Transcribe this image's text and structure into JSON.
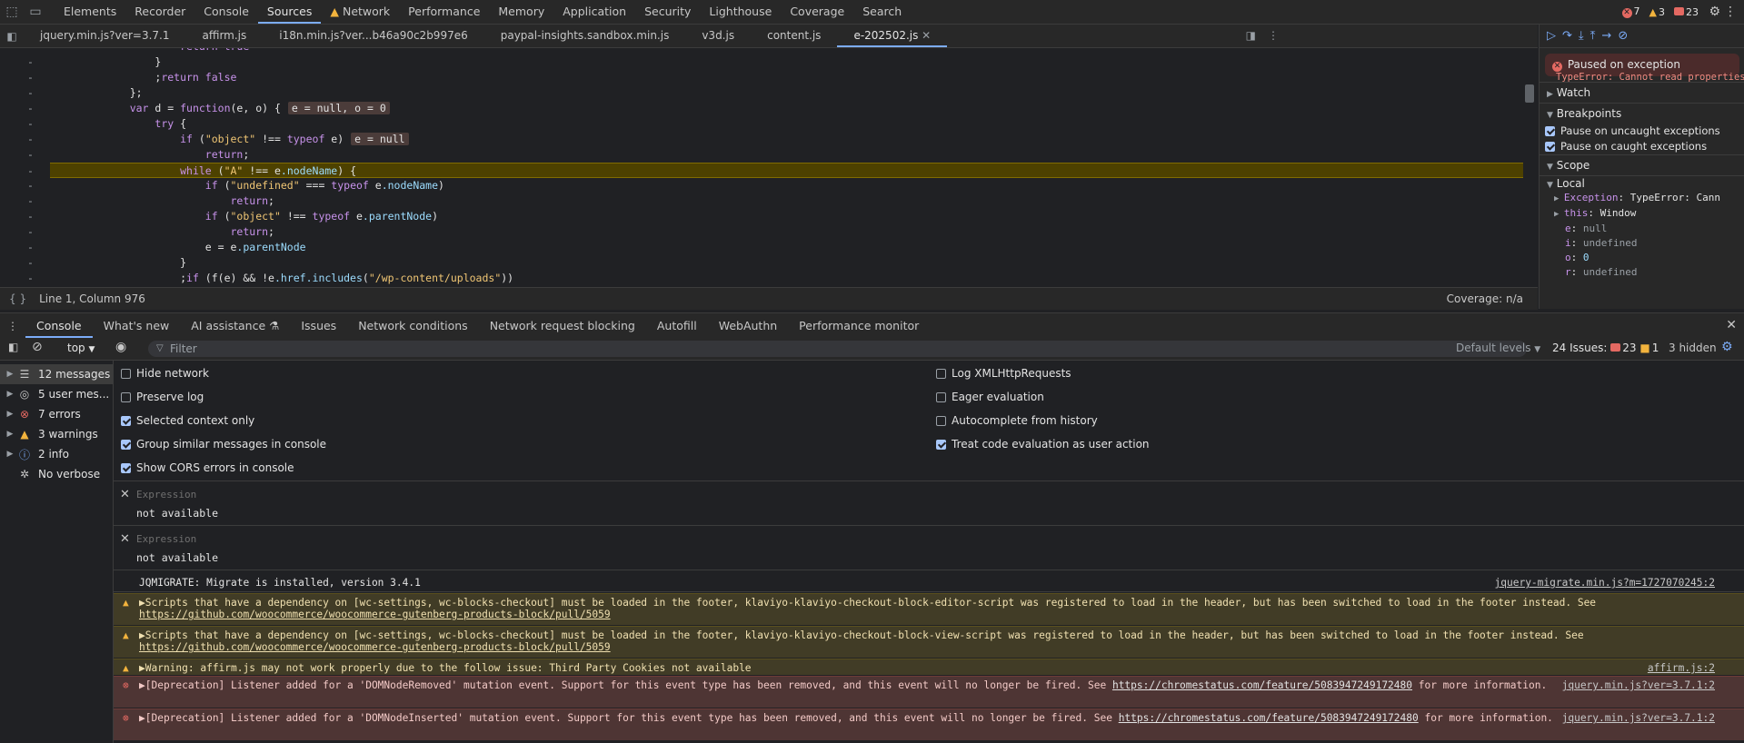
{
  "toolbar": {
    "tabs": [
      "Elements",
      "Recorder",
      "Console",
      "Sources",
      "Network",
      "Performance",
      "Memory",
      "Application",
      "Security",
      "Lighthouse",
      "Coverage",
      "Search"
    ],
    "active_tab": "Sources",
    "error_count": "7",
    "warning_count": "3",
    "issue_count": "23"
  },
  "sources": {
    "file_tabs": [
      "jquery.min.js?ver=3.7.1",
      "affirm.js",
      "i18n.min.js?ver...b46a90c2b997e6",
      "paypal-insights.sandbox.min.js",
      "v3d.js",
      "content.js",
      "e-202502.js"
    ],
    "active_file": "e-202502.js",
    "status_position": "Line 1, Column 976",
    "coverage": "Coverage: n/a"
  },
  "code_lines": [
    {
      "g": "-",
      "t": "            return true"
    },
    {
      "g": "-",
      "t": "        }"
    },
    {
      "g": "-",
      "t": "        ;return false"
    },
    {
      "g": "-",
      "t": "    };"
    },
    {
      "g": "-",
      "t": "    var d = function(e, o) {",
      "inline": "e = null, o = 0"
    },
    {
      "g": "-",
      "t": "        try {"
    },
    {
      "g": "-",
      "t": "            if (\"object\" !== typeof e)",
      "inline": "e = null"
    },
    {
      "g": "-",
      "t": "                return;"
    },
    {
      "g": "-",
      "t": "            while (\"A\" !== e.nodeName) {",
      "exec": true
    },
    {
      "g": "-",
      "t": "                if (\"undefined\" === typeof e.nodeName)"
    },
    {
      "g": "-",
      "t": "                    return;"
    },
    {
      "g": "-",
      "t": "                if (\"object\" !== typeof e.parentNode)"
    },
    {
      "g": "-",
      "t": "                    return;"
    },
    {
      "g": "-",
      "t": "                e = e.parentNode"
    },
    {
      "g": "-",
      "t": "            }"
    },
    {
      "g": "-",
      "t": "            ;if (f(e) && !e.href.includes(\"/wp-content/uploads\"))"
    }
  ],
  "debugger": {
    "paused_title": "Paused on exception",
    "paused_msg": "TypeError: Cannot read properties of null",
    "watch": "Watch",
    "breakpoints": "Breakpoints",
    "pause_uncaught": "Pause on uncaught exceptions",
    "pause_caught": "Pause on caught exceptions",
    "scope": "Scope",
    "local": "Local",
    "scope_vars": [
      {
        "k": "Exception",
        "v": "TypeError: Cann",
        "expand": true
      },
      {
        "k": "this",
        "v": "Window",
        "expand": true
      },
      {
        "k": "e",
        "v": "null"
      },
      {
        "k": "i",
        "v": "undefined"
      },
      {
        "k": "o",
        "v": "0"
      },
      {
        "k": "r",
        "v": "undefined"
      }
    ]
  },
  "drawer": {
    "tabs": [
      "Console",
      "What's new",
      "AI assistance",
      "Issues",
      "Network conditions",
      "Network request blocking",
      "Autofill",
      "WebAuthn",
      "Performance monitor"
    ],
    "active": "Console"
  },
  "console_toolbar": {
    "context": "top",
    "filter_placeholder": "Filter",
    "levels": "Default levels",
    "issues_label": "24 Issues:",
    "issues_err": "23",
    "issues_info": "1",
    "hidden": "3 hidden"
  },
  "console_sidebar": [
    {
      "label": "12 messages",
      "icon": "list"
    },
    {
      "label": "5 user mes...",
      "icon": "user"
    },
    {
      "label": "7 errors",
      "icon": "error"
    },
    {
      "label": "3 warnings",
      "icon": "warning"
    },
    {
      "label": "2 info",
      "icon": "info"
    },
    {
      "label": "No verbose",
      "icon": "verbose"
    }
  ],
  "settings": {
    "left": [
      {
        "label": "Hide network",
        "checked": false
      },
      {
        "label": "Preserve log",
        "checked": false
      },
      {
        "label": "Selected context only",
        "checked": true
      },
      {
        "label": "Group similar messages in console",
        "checked": true
      },
      {
        "label": "Show CORS errors in console",
        "checked": true
      }
    ],
    "right": [
      {
        "label": "Log XMLHttpRequests",
        "checked": false
      },
      {
        "label": "Eager evaluation",
        "checked": false
      },
      {
        "label": "Autocomplete from history",
        "checked": false
      },
      {
        "label": "Treat code evaluation as user action",
        "checked": true
      }
    ]
  },
  "expressions": [
    {
      "placeholder": "Expression",
      "value": "not available"
    },
    {
      "placeholder": "Expression",
      "value": "not available"
    }
  ],
  "messages": [
    {
      "level": "log",
      "text": "JQMIGRATE: Migrate is installed, version 3.4.1",
      "source": "jquery-migrate.min.js?m=1727070245:2"
    },
    {
      "level": "warning",
      "text": "▶Scripts that have a dependency on [wc-settings, wc-blocks-checkout] must be loaded in the footer, klaviyo-klaviyo-checkout-block-editor-script was registered to load in the header, but has been switched to load in the footer instead. See",
      "link": "https://github.com/woocommerce/woocommerce-gutenberg-products-block/pull/5059",
      "source": ""
    },
    {
      "level": "warning",
      "text": "▶Scripts that have a dependency on [wc-settings, wc-blocks-checkout] must be loaded in the footer, klaviyo-klaviyo-checkout-block-view-script was registered to load in the header, but has been switched to load in the footer instead. See",
      "link": "https://github.com/woocommerce/woocommerce-gutenberg-products-block/pull/5059",
      "source": ""
    },
    {
      "level": "warning",
      "text": "▶Warning: affirm.js may not work properly due to the follow issue: Third Party Cookies not available",
      "source": "affirm.js:2"
    },
    {
      "level": "error",
      "text": "▶[Deprecation] Listener added for a 'DOMNodeRemoved' mutation event. Support for this event type has been removed, and this event will no longer be fired. See",
      "link": "https://chromestatus.com/feature/5083947249172480",
      "after": " for more information.",
      "source": "jquery.min.js?ver=3.7.1:2"
    },
    {
      "level": "error",
      "text": "▶[Deprecation] Listener added for a 'DOMNodeInserted' mutation event. Support for this event type has been removed, and this event will no longer be fired. See",
      "link": "https://chromestatus.com/feature/5083947249172480",
      "after": " for more information.",
      "source": "jquery.min.js?ver=3.7.1:2"
    }
  ]
}
